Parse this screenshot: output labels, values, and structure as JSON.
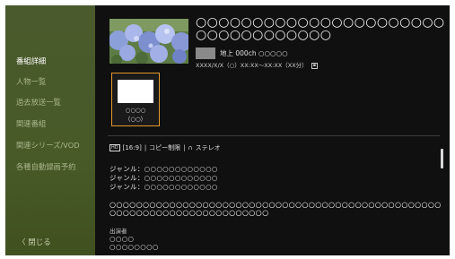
{
  "sidebar": {
    "items": [
      {
        "label": "番組詳細",
        "active": true
      },
      {
        "label": "人物一覧",
        "active": false
      },
      {
        "label": "過去放送一覧",
        "active": false
      },
      {
        "label": "関連番組",
        "active": false
      },
      {
        "label": "関連シリーズ/VOD",
        "active": false
      },
      {
        "label": "各種自動録画予約",
        "active": false
      }
    ],
    "close_label": "〈 閉じる"
  },
  "program": {
    "title": "○○○○○○○○○○○○○○○○○○○○○○○○○○○○○○○○○○",
    "channel": "地上 000ch ○○○○○",
    "air_time": "XXXX/X/X（○）XX:XX〜XX:XX（XX分）"
  },
  "card": {
    "line1": "○○○○",
    "line2": "（○○）"
  },
  "features": {
    "aspect": "[16:9]",
    "copy": "コピー制限",
    "audio": "ステレオ",
    "sep": "|"
  },
  "genres": [
    "ジャンル：○○○○○○○○○○○○",
    "ジャンル：○○○○○○○○○○○○",
    "ジャンル：○○○○○○○○○○○○"
  ],
  "description": "○○○○○○○○○○○○○○○○○○○○○○○○○○○○○○○○○○○○○○○○○○○○○○○○○○○○○○○○○○○○○○○○○○○○○○○○○○",
  "cast": {
    "label": "出演者",
    "names": [
      "○○○○",
      "○○○○○○○○"
    ]
  },
  "colors": {
    "sidebar_bg": "#475a28",
    "main_bg": "#101010",
    "card_focus": "#e39a2a",
    "text_active": "#ffffff",
    "text_inactive": "#a9b58a"
  }
}
